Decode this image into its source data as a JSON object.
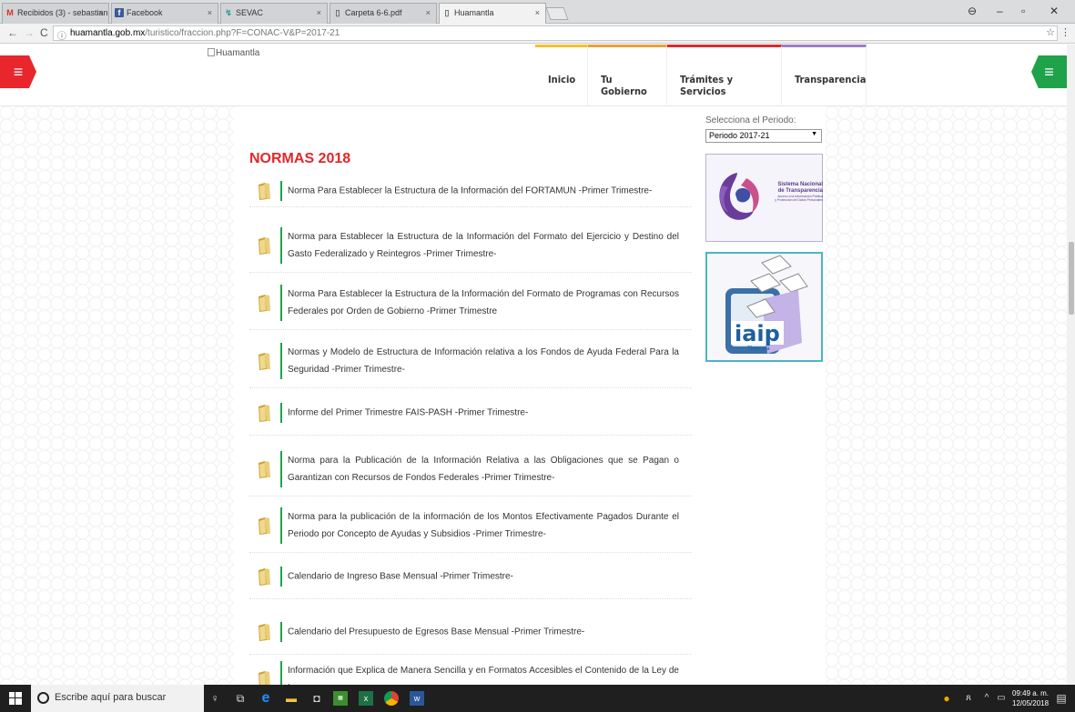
{
  "browser": {
    "tabs": [
      {
        "title": "Recibidos (3) - sebastian",
        "icon": "gmail-icon"
      },
      {
        "title": "Facebook",
        "icon": "facebook-icon"
      },
      {
        "title": "SEVAC",
        "icon": "sevac-icon"
      },
      {
        "title": "Carpeta 6-6.pdf",
        "icon": "document-icon"
      },
      {
        "title": "Huamantla",
        "icon": "document-icon",
        "active": true
      }
    ],
    "url_domain": "huamantla.gob.mx",
    "url_path": "/turistico/fraccion.php?F=CONAC-V&P=2017-21"
  },
  "header": {
    "logo_alt": "Huamantla",
    "menu": [
      {
        "label": "Inicio",
        "color": "#f2c12e"
      },
      {
        "label": "Tu Gobierno",
        "color": "#e8a23c"
      },
      {
        "label": "Trámites y Servicios",
        "color": "#d92b2f"
      },
      {
        "label": "Transparencia",
        "color": "#9b7ec8"
      }
    ],
    "colors": {
      "left_menu": "#e8262b",
      "right_menu": "#1fa24a"
    }
  },
  "content": {
    "heading": "NORMAS 2018",
    "heading_color": "#e3262b",
    "documents": [
      "Norma Para Establecer la Estructura de la Información del FORTAMUN -Primer Trimestre-",
      "Norma para Establecer la Estructura de la Información del Formato del Ejercicio y Destino del Gasto Federalizado y Reintegros -Primer Trimestre-",
      "Norma Para Establecer la Estructura de la Información del Formato de Programas con Recursos Federales por Orden de Gobierno -Primer Trimestre",
      "Normas y Modelo de Estructura de Información relativa a los Fondos de Ayuda Federal Para la Seguridad -Primer Trimestre-",
      "Informe del Primer Trimestre FAIS-PASH -Primer Trimestre-",
      "Norma para la Publicación de la Información Relativa a las Obligaciones que se Pagan o Garantizan con Recursos de Fondos Federales -Primer Trimestre-",
      "Norma para la publicación de la información de los Montos Efectivamente Pagados Durante el Periodo por Concepto de Ayudas y Subsidios -Primer Trimestre-",
      "Calendario de Ingreso Base Mensual -Primer Trimestre-",
      "Calendario del Presupuesto de Egresos Base Mensual -Primer Trimestre-",
      "Información que Explica de Manera Sencilla y en Formatos Accesibles el Contenido de la Ley de Ingresos y"
    ]
  },
  "sidebar": {
    "period_label": "Selecciona el Periodo:",
    "period_value": "Periodo 2017-21",
    "banner1": {
      "line1": "Sistema Nacional",
      "line2": "de Transparencia",
      "line3": "Acceso a la Información Pública",
      "line4": "y Protección de Datos Personales"
    },
    "banner2": {
      "text": "iaip",
      "sub": "Tlaxcala"
    }
  },
  "taskbar": {
    "search_placeholder": "Escribe aquí para buscar",
    "time": "09:49 a. m.",
    "date": "12/05/2018"
  }
}
